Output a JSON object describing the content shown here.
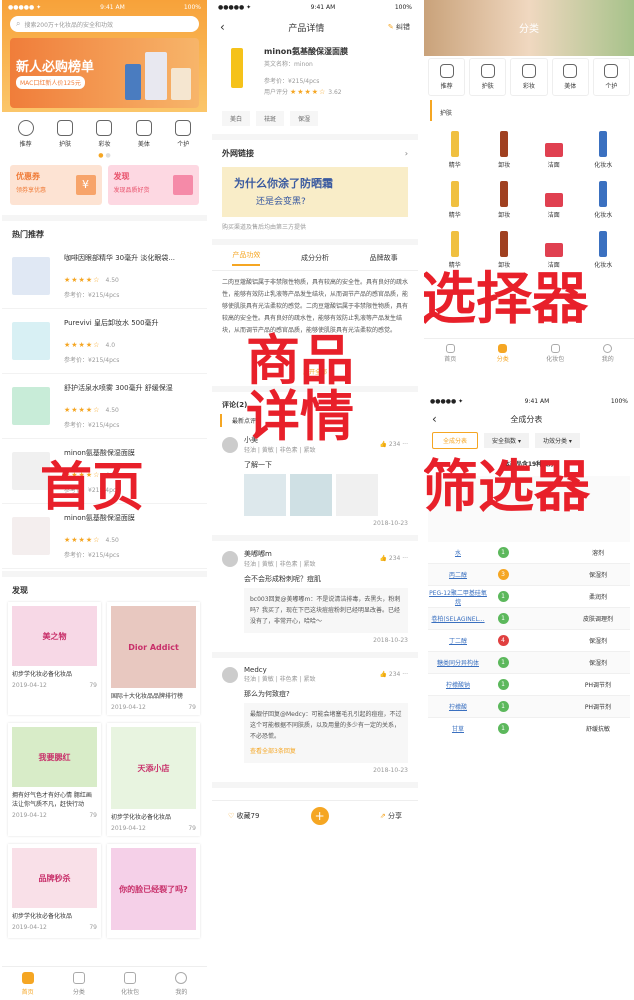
{
  "home": {
    "status": {
      "carrier": "●●●●● ✦",
      "time": "9:41 AM",
      "battery": "100%"
    },
    "search_placeholder": "搜索200万+化妆品的安全和功效",
    "banner": {
      "title": "新人必购榜单",
      "sub": "MAC口红新人价125元"
    },
    "cats": [
      "推荐",
      "护肤",
      "彩妆",
      "美体",
      "个护"
    ],
    "coupon": {
      "title": "优惠券",
      "sub": "领券享优惠"
    },
    "discover": {
      "title": "发现",
      "sub": "发现品质好货"
    },
    "hot_title": "热门推荐",
    "products": [
      {
        "name": "咖啡因眼部精华 30毫升 淡化眼袋...",
        "rating": "4.50",
        "price": "参考价：¥215/4pcs"
      },
      {
        "name": "Purevivi 皇后卸妆水 500毫升",
        "rating": "4.0",
        "price": "参考价：¥215/4pcs"
      },
      {
        "name": "舒护活泉水喷雾 300毫升 舒缓保湿",
        "rating": "4.50",
        "price": "参考价：¥215/4pcs"
      },
      {
        "name": "minon氨基酸保湿面膜",
        "rating": "4.50",
        "price": "参考价：¥215/4pcs"
      },
      {
        "name": "minon氨基酸保湿面膜",
        "rating": "4.50",
        "price": "参考价：¥215/4pcs"
      }
    ],
    "discover_title": "发现",
    "cards": [
      {
        "title": "初步学化妆必备化妆品",
        "date": "2019-04-12",
        "likes": "79",
        "img": "美之物"
      },
      {
        "title": "国际十大化妆品品牌排行榜",
        "date": "2019-04-12",
        "likes": "79",
        "img": "Dior Addict"
      },
      {
        "title": "拥有好气色才有好心情 腮红画法让你气质不凡，赶快行动",
        "date": "2019-04-12",
        "likes": "79",
        "img": "我要腮红"
      },
      {
        "title": "初步学化妆必备化妆品",
        "date": "2019-04-12",
        "likes": "79",
        "img": "天添小店"
      },
      {
        "title": "初步学化妆必备化妆品",
        "date": "2019-04-12",
        "likes": "79",
        "img": "品牌秒杀"
      },
      {
        "title": "",
        "date": "",
        "likes": "",
        "img": "你的脸已经裂了吗?"
      }
    ],
    "nav": [
      "首页",
      "分类",
      "化妆包",
      "我的"
    ]
  },
  "detail": {
    "status": {
      "carrier": "●●●●● ✦",
      "time": "9:41 AM",
      "battery": "100%"
    },
    "title": "产品详情",
    "correct": "纠错",
    "product": {
      "name": "minon氨基酸保湿面膜",
      "en": "英文名称：minon",
      "price": "参考价：¥215/4pcs",
      "score_label": "用户评分",
      "score": "3.62"
    },
    "tags": [
      "美白",
      "祛斑",
      "保湿"
    ],
    "link_title": "外网链接",
    "link_banner": {
      "line1": "为什么你涂了防晒霜",
      "line2": "还是会变黑?"
    },
    "link_note": "购买渠道及售后均由第三方提供",
    "tabs": [
      "产品功效",
      "成分分析",
      "品牌故事"
    ],
    "desc": "二肉豆蔻酸铝属于非禁限性物质，具有较高的安全性。具有良好的疏水性，能够有效防止乳液等产品发生结块，从而调节产品的感官品质，能够使肌肤具有光洁柔软的感觉。二肉豆蔻酸铝属于非禁限性物质，具有较高的安全性。具有良好的疏水性，能够有效防止乳液等产品发生结块，从而调节产品的感官品质，能够使肌肤具有光洁柔软的感觉。",
    "expand": "展开全部",
    "comments_title": "评论(2)",
    "latest": "最新点评",
    "comments": [
      {
        "user": "小美",
        "meta": "轻油 | 黄敏 | 非色素 | 紧致",
        "likes": "234",
        "text": "了解一下",
        "date": "2018-10-23",
        "reply": "",
        "replymore": ""
      },
      {
        "user": "美嘟嘟m",
        "meta": "轻油 | 黄敏 | 非色素 | 紧致",
        "likes": "234",
        "text": "会不会形成粉刺呢？痘肌",
        "date": "2018-10-23",
        "reply": "bc003回复@美嘟嘟m：不是说清洁排毒，去黑头，粉刺吗？我买了，现在下巴这块痘痘粉刺已经明显改善。已经没有了，非常开心，哈哈～",
        "replymore": ""
      },
      {
        "user": "Medcy",
        "meta": "轻油 | 黄敏 | 非色素 | 紧致",
        "likes": "234",
        "text": "那么为何致痘?",
        "date": "2018-10-23",
        "reply": "最靓仔回复@Medcy：可能会堵塞毛孔引起的痘痘，不过这个可能根据不同肤质，以及用量的多少有一定的关系，不必恐慌。",
        "replymore": "查看全部3条回复"
      }
    ],
    "bottom": {
      "fav": "收藏79",
      "share": "分享"
    }
  },
  "category": {
    "title": "分类",
    "cats": [
      "推荐",
      "护肤",
      "彩妆",
      "美体",
      "个护"
    ],
    "section": "护肤",
    "items": [
      [
        "精华",
        "卸妆",
        "洁面",
        "化妆水"
      ],
      [
        "精华",
        "卸妆",
        "洁面",
        "化妆水"
      ],
      [
        "精华",
        "卸妆",
        "洁面",
        "化妆水"
      ]
    ],
    "nav": [
      "首页",
      "分类",
      "化妆包",
      "我的"
    ]
  },
  "filter": {
    "status": {
      "carrier": "●●●●● ✦",
      "time": "9:41 AM",
      "battery": "100%"
    },
    "title": "全成分表",
    "btns": [
      "全成分表",
      "安全指数",
      "功效分类"
    ],
    "summary": "本产品含19种成分",
    "rows": [
      {
        "name": "水",
        "safe": "1",
        "func": "溶剂"
      },
      {
        "name": "丙二醇",
        "safe": "3",
        "func": "保湿剂"
      },
      {
        "name": "PEG-12聚二甲基硅氧烷",
        "safe": "1",
        "func": "柔润剂"
      },
      {
        "name": "卷柏(SELAGINEL...",
        "safe": "1",
        "func": "皮肤调理剂"
      },
      {
        "name": "丁二醇",
        "safe": "4",
        "func": "保湿剂"
      },
      {
        "name": "糖类同分异构体",
        "safe": "1",
        "func": "保湿剂"
      },
      {
        "name": "柠檬酸钠",
        "safe": "1",
        "func": "PH调节剂"
      },
      {
        "name": "柠檬酸",
        "safe": "1",
        "func": "PH调节剂"
      },
      {
        "name": "甘草",
        "safe": "1",
        "func": "舒缓抗敏"
      }
    ]
  },
  "overlays": {
    "home": "首页",
    "detail1": "商品",
    "detail2": "详情",
    "selector": "选择器",
    "filter": "筛选器"
  },
  "colors": {
    "accent": "#f5a623",
    "red": "#e8202a",
    "green": "#5cb85c"
  }
}
